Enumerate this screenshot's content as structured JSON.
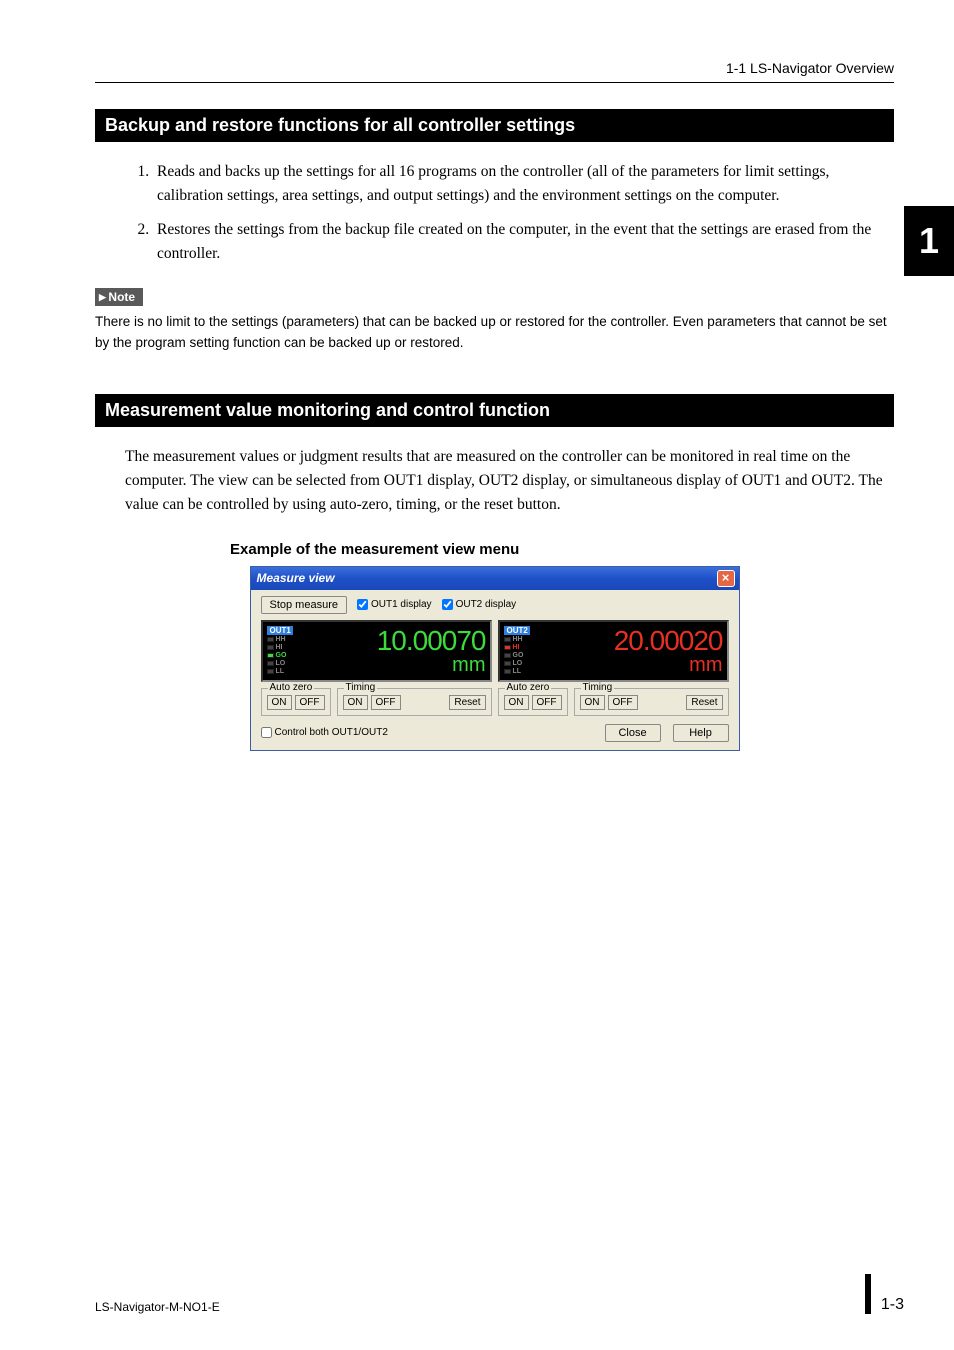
{
  "header": {
    "breadcrumb": "1-1 LS-Navigator Overview"
  },
  "side_tab": "1",
  "section1": {
    "title": "Backup and restore functions for all controller settings",
    "items": [
      "Reads and backs up the settings for all 16 programs on the controller (all of the parameters for limit settings, calibration settings, area settings, and output settings) and the environment settings on the computer.",
      "Restores the settings from the backup file created on the computer, in the event that the settings are erased from the controller."
    ],
    "note_label": "Note",
    "note_text": "There is no limit to the settings (parameters) that can be backed up or restored for the controller. Even parameters that cannot be set by the program setting function can be backed up or restored."
  },
  "section2": {
    "title": "Measurement value monitoring and control function",
    "paragraph": "The measurement values or judgment results that are measured on the controller can be monitored in real time on the computer. The view can be selected from OUT1 display, OUT2 display, or simultaneous display of OUT1 and OUT2. The value can be controlled by using auto-zero, timing, or the reset button.",
    "caption": "Example of the measurement view menu"
  },
  "dialog": {
    "title": "Measure view",
    "stop_btn": "Stop measure",
    "chk_out1": "OUT1 display",
    "chk_out2": "OUT2 display",
    "out1": {
      "label": "OUT1",
      "value": "10.00070",
      "unit": "mm",
      "statuses": [
        "HH",
        "HI",
        "GO",
        "LO",
        "LL"
      ]
    },
    "out2": {
      "label": "OUT2",
      "value": "20.00020",
      "unit": "mm",
      "statuses": [
        "HH",
        "HI",
        "GO",
        "LO",
        "LL"
      ]
    },
    "auto_zero": "Auto zero",
    "timing": "Timing",
    "on": "ON",
    "off": "OFF",
    "reset": "Reset",
    "control_both": "Control both OUT1/OUT2",
    "close": "Close",
    "help": "Help"
  },
  "footer": {
    "left": "LS-Navigator-M-NO1-E",
    "right": "1-3"
  }
}
